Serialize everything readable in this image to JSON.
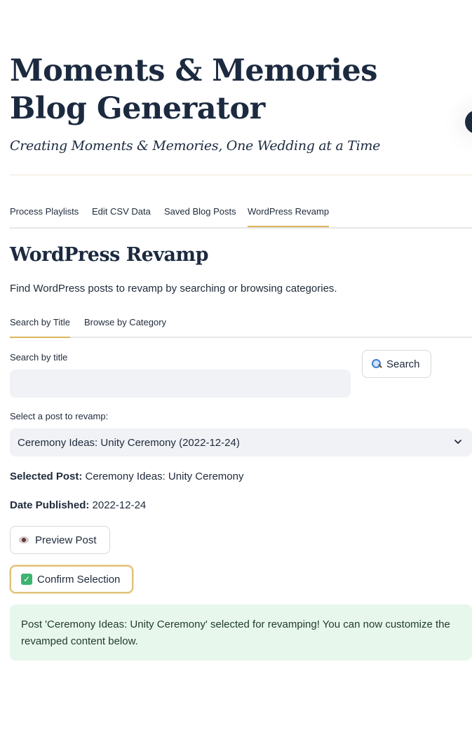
{
  "app": {
    "title": "Moments & Memories Blog Generator",
    "subtitle": "Creating Moments & Memories, One Wedding at a Time"
  },
  "main_tabs": [
    {
      "label": "Process Playlists",
      "active": false
    },
    {
      "label": "Edit CSV Data",
      "active": false
    },
    {
      "label": "Saved Blog Posts",
      "active": false
    },
    {
      "label": "WordPress Revamp",
      "active": true
    }
  ],
  "section": {
    "heading": "WordPress Revamp",
    "description": "Find WordPress posts to revamp by searching or browsing categories."
  },
  "sub_tabs": [
    {
      "label": "Search by Title",
      "active": true
    },
    {
      "label": "Browse by Category",
      "active": false
    }
  ],
  "search": {
    "label": "Search by title",
    "value": "",
    "placeholder": "",
    "button_label": "Search",
    "button_icon": "magnifier-icon"
  },
  "post_select": {
    "label": "Select a post to revamp:",
    "selected": "Ceremony Ideas: Unity Ceremony (2022-12-24)"
  },
  "details": {
    "selected_post_label": "Selected Post:",
    "selected_post_value": "Ceremony Ideas: Unity Ceremony",
    "date_label": "Date Published:",
    "date_value": "2022-12-24"
  },
  "actions": {
    "preview_label": "Preview Post",
    "preview_icon": "eye-icon",
    "confirm_label": "Confirm Selection",
    "confirm_icon": "check-box-icon"
  },
  "alert": {
    "message": "Post 'Ceremony Ideas: Unity Ceremony' selected for revamping! You can now customize the revamped content below."
  },
  "colors": {
    "accent": "#d9b55a",
    "heading": "#1c2a40",
    "input_bg": "#f0f2f6",
    "success_bg": "#e8f7ec"
  }
}
